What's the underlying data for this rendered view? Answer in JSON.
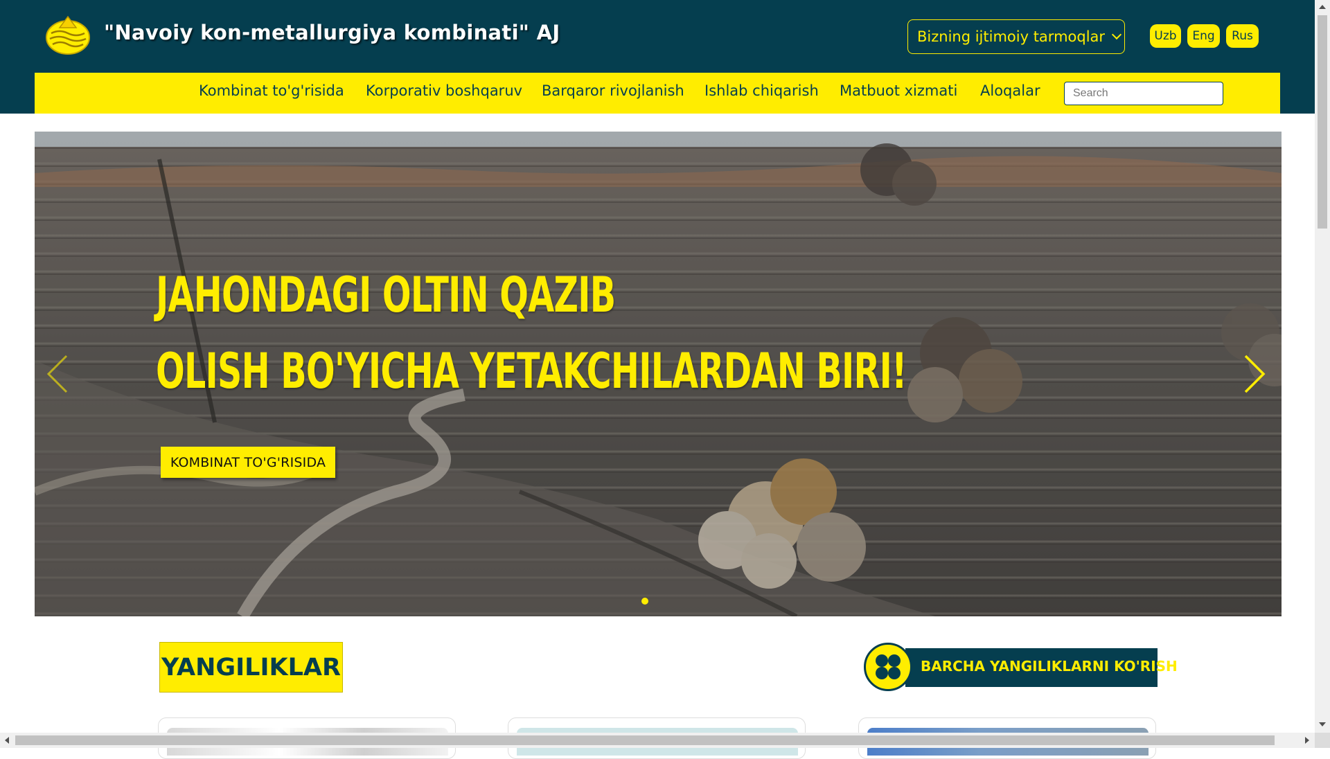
{
  "header": {
    "title": "\"Navoiy kon-metallurgiya kombinati\" AJ",
    "social_label": "Bizning ijtimoiy tarmoqlar",
    "languages": [
      "Uzb",
      "Eng",
      "Rus"
    ]
  },
  "nav": {
    "items": [
      "Kombinat to'g'risida",
      "Korporativ boshqaruv",
      "Barqaror rivojlanish",
      "Ishlab chiqarish",
      "Matbuot xizmati",
      "Aloqalar"
    ],
    "search_placeholder": "Search"
  },
  "hero": {
    "line1": "JAHONDAGI OLTIN QAZIB",
    "line2": "OLISH BO'YICHA YETAKCHILARDAN BIRI!",
    "button": "KOMBINAT TO'G'RISIDA"
  },
  "news": {
    "title": "YANGILIKLAR",
    "all_news_label": "BARCHA YANGILIKLARNI KO'RISH"
  },
  "colors": {
    "brand_dark": "#053e4f",
    "brand_yellow": "#ffed00"
  },
  "icons": [
    "logo-icon",
    "chevron-down-icon",
    "chevron-left-icon",
    "chevron-right-icon",
    "grid-icon"
  ]
}
